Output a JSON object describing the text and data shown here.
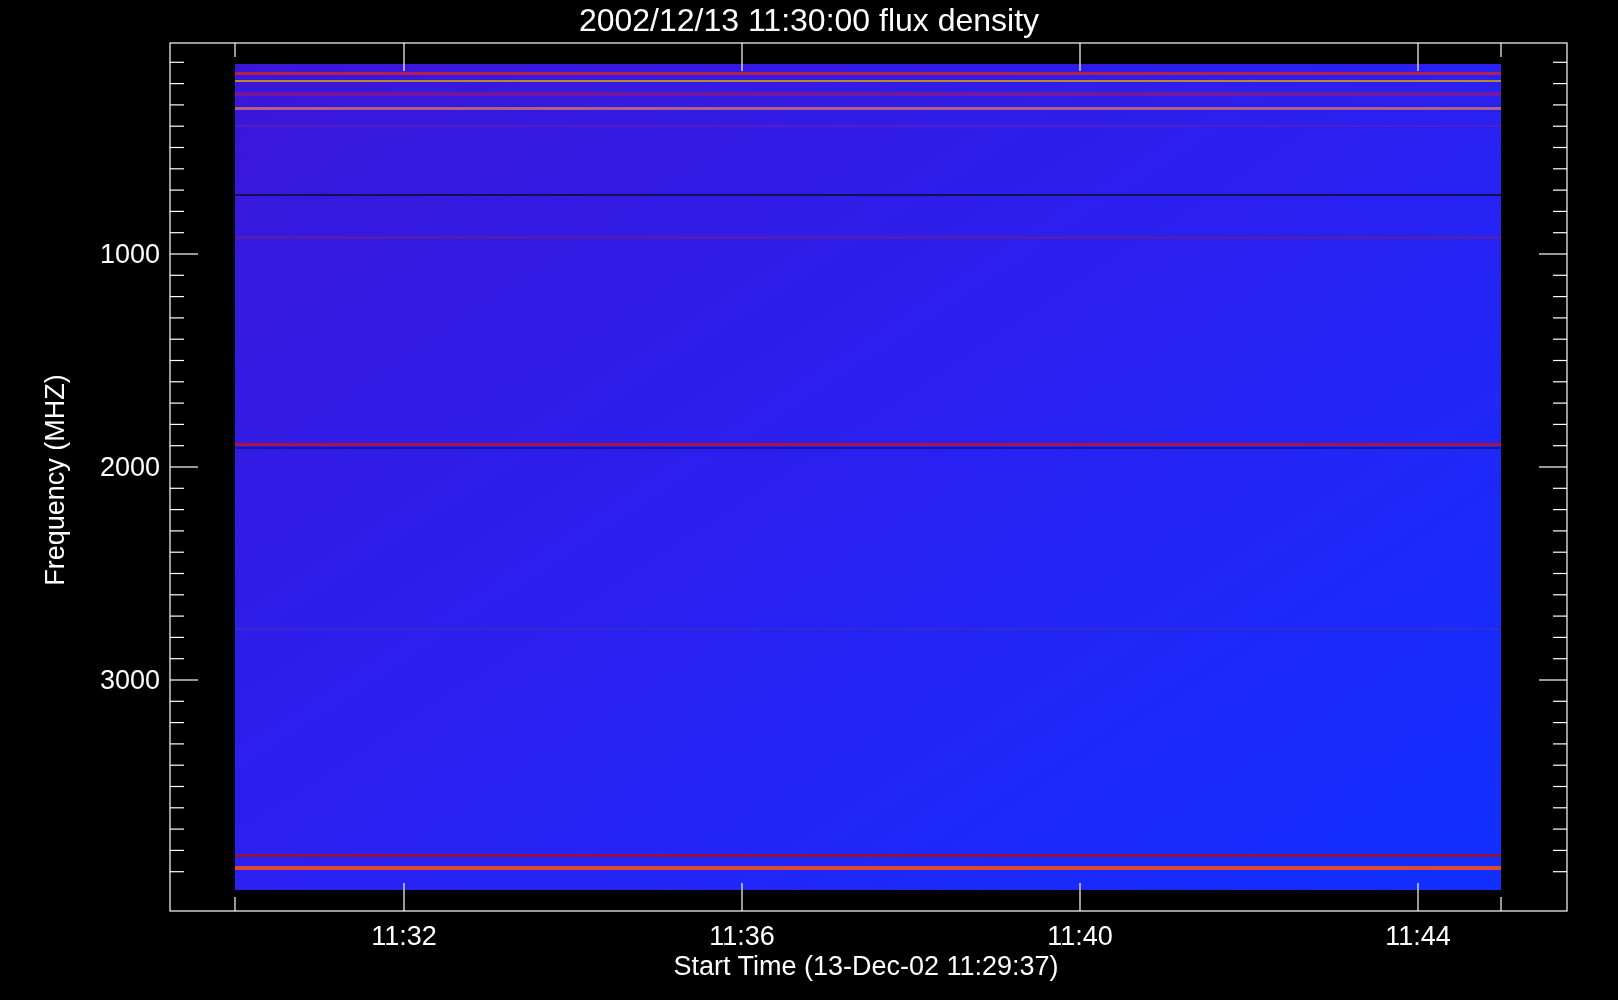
{
  "plot": {
    "title": "2002/12/13 11:30:00 flux density",
    "ylabel": "Frequency (MHZ)",
    "xlabel": "Start Time (13-Dec-02 11:29:37)",
    "yticks": [
      "1000",
      "2000",
      "3000"
    ],
    "xticks": [
      "11:32",
      "11:36",
      "11:40",
      "11:44"
    ]
  }
}
